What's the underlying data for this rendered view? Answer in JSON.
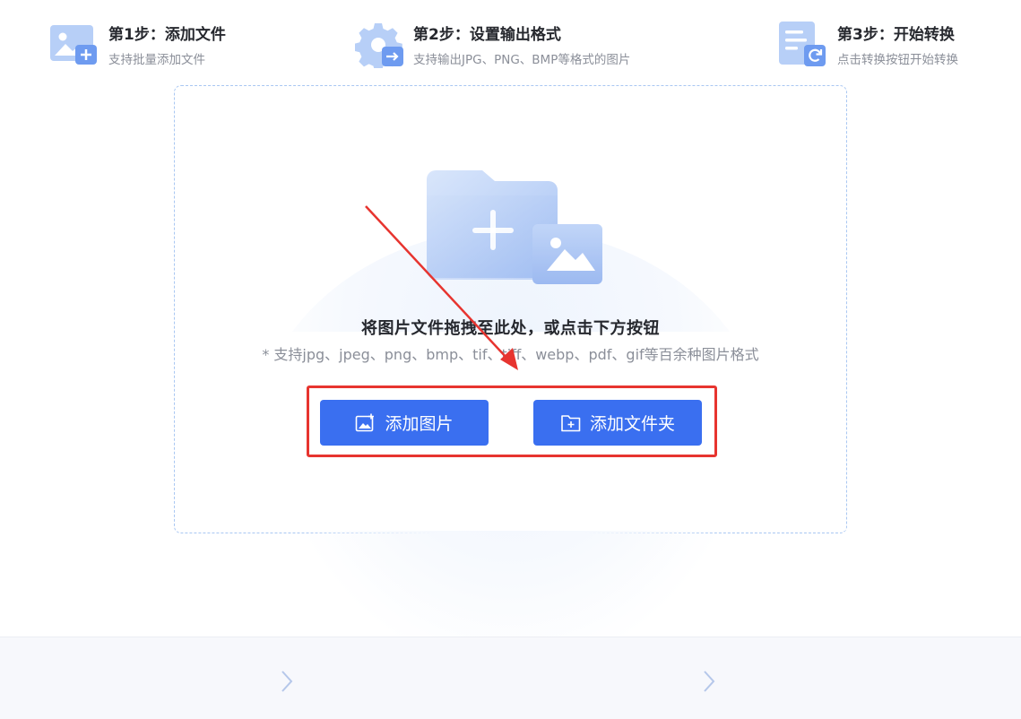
{
  "dropzone": {
    "title": "将图片文件拖拽至此处，或点击下方按钮",
    "subtitle": "* 支持jpg、jpeg、png、bmp、tif、tiff、webp、pdf、gif等百余种图片格式"
  },
  "buttons": {
    "add_image": "添加图片",
    "add_folder": "添加文件夹"
  },
  "steps": [
    {
      "title": "第1步：添加文件",
      "desc": "支持批量添加文件",
      "icon": "add-image-icon"
    },
    {
      "title": "第2步：设置输出格式",
      "desc": "支持输出JPG、PNG、BMP等格式的图片",
      "icon": "gear-export-icon"
    },
    {
      "title": "第3步：开始转换",
      "desc": "点击转换按钮开始转换",
      "icon": "document-refresh-icon"
    }
  ],
  "colors": {
    "accent": "#3a6ff0",
    "highlight": "#e7342f",
    "dashed_border": "#a9c7f2"
  }
}
